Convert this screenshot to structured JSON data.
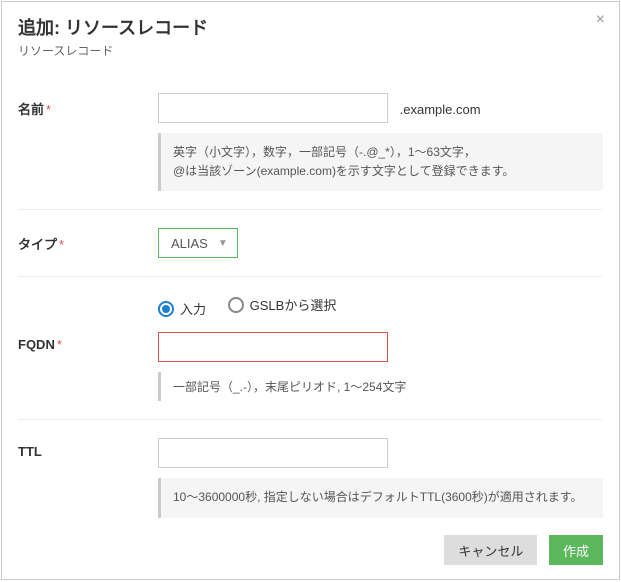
{
  "dialog": {
    "title": "追加: リソースレコード",
    "subtitle": "リソースレコード",
    "close_glyph": "×"
  },
  "name_field": {
    "label": "名前",
    "required_mark": "*",
    "value": "",
    "suffix": ".example.com",
    "hint_line1": "英字（小文字），数字，一部記号（-.@_*），1〜63文字，",
    "hint_line2": "@は当該ゾーン(example.com)を示す文字として登録できます。"
  },
  "type_field": {
    "label": "タイプ",
    "required_mark": "*",
    "selected": "ALIAS",
    "caret": "▼"
  },
  "fqdn_field": {
    "radio_options": [
      {
        "value": "input",
        "label": "入力",
        "selected": true
      },
      {
        "value": "gslb",
        "label": "GSLBから選択",
        "selected": false
      }
    ],
    "label": "FQDN",
    "required_mark": "*",
    "value": "",
    "hint": "一部記号（_.-），末尾ピリオド, 1〜254文字"
  },
  "ttl_field": {
    "label": "TTL",
    "value": "",
    "hint": "10〜3600000秒, 指定しない場合はデフォルトTTL(3600秒)が適用されます。"
  },
  "footer": {
    "cancel": "キャンセル",
    "submit": "作成"
  }
}
